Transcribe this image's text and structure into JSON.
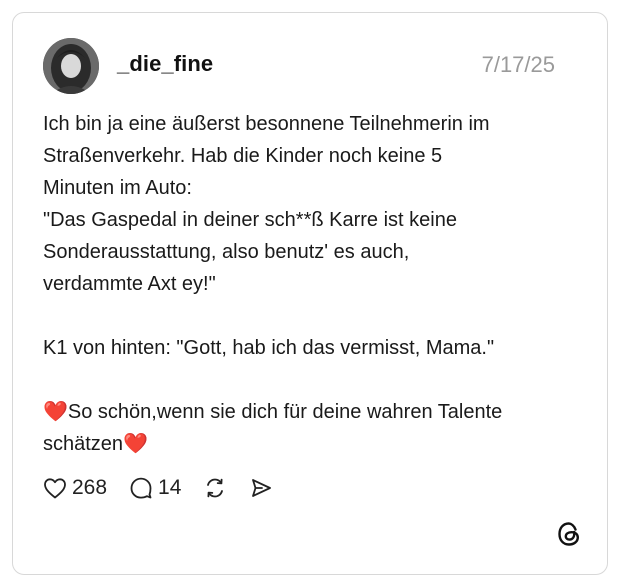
{
  "post": {
    "username": "_die_fine",
    "date": "7/17/25",
    "text_lines": [
      "Ich bin ja eine äußerst besonnene Teilnehmerin im",
      "Straßenverkehr. Hab die Kinder noch keine 5",
      "Minuten im Auto:",
      "\"Das Gaspedal in deiner sch**ß Karre ist keine",
      "Sonderausstattung, also benutz' es auch,",
      "verdammte Axt ey!\"",
      "",
      "K1 von hinten: \"Gott, hab ich das vermisst, Mama.\"",
      "",
      "❤️So schön,wenn sie dich für deine wahren Talente",
      "schätzen❤️"
    ]
  },
  "actions": {
    "likes": "268",
    "comments": "14"
  },
  "icons": {
    "like": "heart-icon",
    "comment": "comment-bubble-icon",
    "repost": "repost-icon",
    "share": "send-icon",
    "brand": "threads-logo-icon"
  },
  "colors": {
    "text": "#1a1a1a",
    "muted": "#9a9a9a",
    "border": "#d8d8d8",
    "heart_emoji": "#e0245e"
  }
}
